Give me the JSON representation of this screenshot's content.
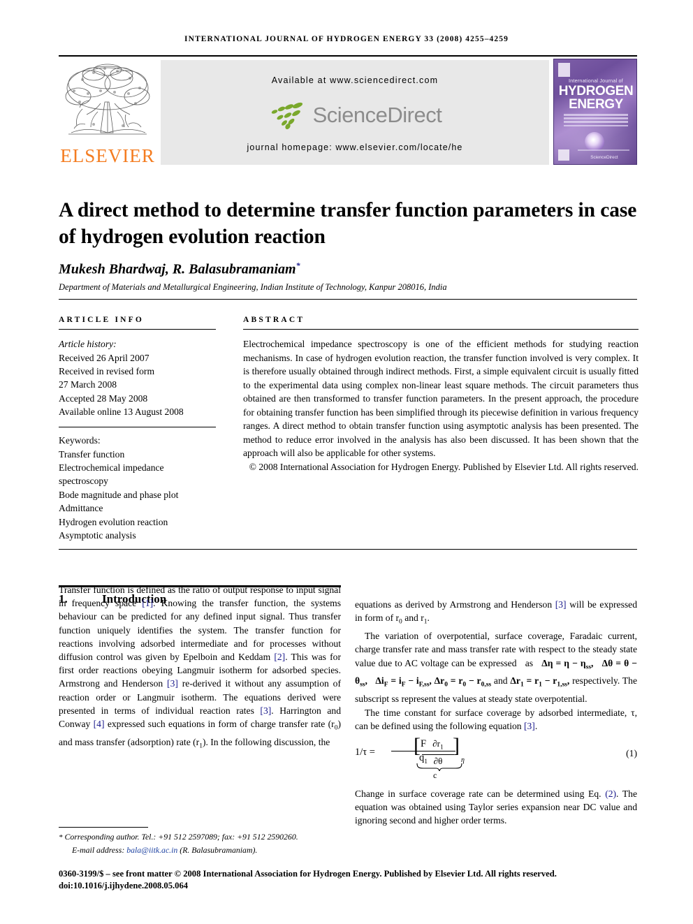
{
  "running_head": "International Journal of Hydrogen Energy 33 (2008) 4255–4259",
  "masthead": {
    "publisher_name": "ELSEVIER",
    "available_at": "Available at www.sciencedirect.com",
    "sciencedirect_logo_text": "ScienceDirect",
    "journal_homepage": "journal homepage: www.elsevier.com/locate/he",
    "cover": {
      "line1": "International Journal of",
      "line2": "HYDROGEN",
      "line3": "ENERGY",
      "sciencedirect": "ScienceDirect"
    }
  },
  "article": {
    "title": "A direct method to determine transfer function parameters in case of hydrogen evolution reaction",
    "authors": "Mukesh Bhardwaj, R. Balasubramaniam",
    "corresponding_marker": "*",
    "affiliation": "Department of Materials and Metallurgical Engineering, Indian Institute of Technology, Kanpur 208016, India"
  },
  "article_info": {
    "heading": "ARTICLE INFO",
    "history_label": "Article history:",
    "history": [
      "Received 26 April 2007",
      "Received in revised form",
      "27 March 2008",
      "Accepted 28 May 2008",
      "Available online 13 August 2008"
    ],
    "keywords_label": "Keywords:",
    "keywords": [
      "Transfer function",
      "Electrochemical impedance",
      "spectroscopy",
      "Bode magnitude and phase plot",
      "Admittance",
      "Hydrogen evolution reaction",
      "Asymptotic analysis"
    ]
  },
  "abstract": {
    "heading": "ABSTRACT",
    "text": "Electrochemical impedance spectroscopy is one of the efficient methods for studying reaction mechanisms. In case of hydrogen evolution reaction, the transfer function involved is very complex. It is therefore usually obtained through indirect methods. First, a simple equivalent circuit is usually fitted to the experimental data using complex non-linear least square methods. The circuit parameters thus obtained are then transformed to transfer function parameters. In the present approach, the procedure for obtaining transfer function has been simplified through its piecewise definition in various frequency ranges. A direct method to obtain transfer function using asymptotic analysis has been presented. The method to reduce error involved in the analysis has also been discussed. It has been shown that the approach will also be applicable for other systems.",
    "copyright": "© 2008 International Association for Hydrogen Energy. Published by Elsevier Ltd. All rights reserved."
  },
  "introduction": {
    "number": "1.",
    "heading": "Introduction",
    "paragraph_left_1": "Transfer function is defined as the ratio of output response to input signal in frequency space ",
    "ref1": "[1]",
    "paragraph_left_2": ". Knowing the transfer function, the systems behaviour can be predicted for any defined input signal. Thus transfer function uniquely identifies the system. The transfer function for reactions involving adsorbed intermediate and for processes without diffusion control was given by Epelboin and Keddam ",
    "ref2": "[2]",
    "paragraph_left_3": ". This was for first order reactions obeying Langmuir isotherm for adsorbed species. Armstrong and Henderson ",
    "ref3": "[3]",
    "paragraph_left_4": " re-derived it without any assumption of reaction order or Langmuir isotherm. The equations derived were presented in terms of individual reaction rates ",
    "ref4": "[3]",
    "paragraph_left_5": ". Harrington and Conway ",
    "ref5": "[4]",
    "paragraph_left_6": " expressed such equations in form of charge transfer rate (r",
    "paragraph_left_7": ") and mass transfer (adsorption) rate (r",
    "paragraph_left_8": "). In the following discussion, the"
  },
  "right_column": {
    "cont_1": "equations as derived by Armstrong and Henderson ",
    "cont_ref": "[3]",
    "cont_2": " will be expressed in form of r",
    "cont_3": " and r",
    "cont_4": ".",
    "para2_a": "The variation of overpotential, surface coverage, Faradaic current, charge transfer rate and mass transfer rate with respect to the steady state value due to AC voltage can be expressed",
    "para2_as": "as",
    "eq_inline_1": "Δη = η − η",
    "eq_inline_2": "Δθ = θ − θ",
    "eq_inline_3": "Δi",
    "eq_inline_3b": " = i",
    "eq_inline_3c": " − i",
    "eq_inline_4a": "Δr",
    "eq_inline_4b": " = r",
    "eq_inline_4c": " − r",
    "eq_and": "and",
    "eq_inline_5a": "Δr",
    "eq_inline_5b": " = r",
    "eq_inline_5c": " − r",
    "para2_b": "respectively. The subscript ss represent the values at steady state overpotential.",
    "para3_a": "The time constant for surface coverage by adsorbed intermediate, τ, can be defined using the following equation ",
    "para3_ref": "[3]",
    "para3_b": ".",
    "para4_a": "Change in surface coverage rate can be determined using Eq. ",
    "para4_ref": "(2)",
    "para4_b": ". The equation was obtained using Taylor series expansion near DC value and ignoring second and higher order terms."
  },
  "equation1": {
    "lhs": "1/τ =",
    "frac_num": "F",
    "frac_den": "q",
    "frac_den_sub": "1",
    "inner_num": "∂r",
    "inner_num_sub": "1",
    "inner_den": "∂θ",
    "subscript": "η",
    "brace_label": "c",
    "number": "(1)"
  },
  "footnote": {
    "star": "*",
    "corresponding": "Corresponding author. Tel.: +91 512 2597089; fax: +91 512 2590260.",
    "email_label": "E-mail address: ",
    "email": "bala@iitk.ac.in",
    "email_owner": " (R. Balasubramaniam)."
  },
  "imprint": {
    "line": "0360-3199/$ – see front matter © 2008 International Association for Hydrogen Energy. Published by Elsevier Ltd. All rights reserved.",
    "doi": "doi:10.1016/j.ijhydene.2008.05.064"
  },
  "colors": {
    "elsevier_orange": "#f47c20",
    "sciencedirect_green": "#7aa82c",
    "sciencedirect_gray": "#8c8c8c",
    "reference_blue": "#1a1a8c",
    "email_blue": "#1a3fa0",
    "cover_purple": "#6e4f9c",
    "banner_gray": "#e8e8e8"
  }
}
